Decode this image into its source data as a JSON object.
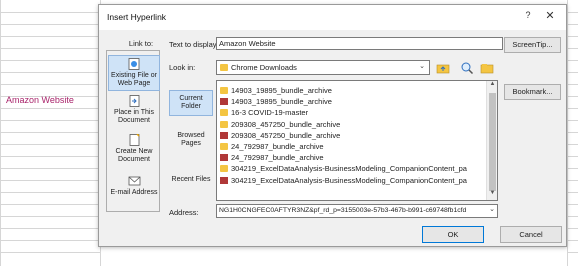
{
  "sheet": {
    "cell_text": "Amazon Website"
  },
  "dialog": {
    "title": "Insert Hyperlink",
    "help": "?",
    "close": "✕",
    "link_to_label": "Link to:",
    "link_to_items": [
      {
        "label": "Existing File or Web Page",
        "icon": "web-page-icon"
      },
      {
        "label": "Place in This Document",
        "icon": "document-place-icon"
      },
      {
        "label": "Create New Document",
        "icon": "new-document-icon"
      },
      {
        "label": "E-mail Address",
        "icon": "email-icon"
      }
    ],
    "text_to_display_label": "Text to display:",
    "text_to_display_value": "Amazon Website",
    "screentip_label": "ScreenTip...",
    "look_in_label": "Look in:",
    "look_in_value": "Chrome Downloads",
    "nav_items": [
      {
        "label": "Current Folder"
      },
      {
        "label": "Browsed Pages"
      },
      {
        "label": "Recent Files"
      }
    ],
    "files": [
      {
        "name": "14903_19895_bundle_archive",
        "type": "folder"
      },
      {
        "name": "14903_19895_bundle_archive",
        "type": "excel"
      },
      {
        "name": "16-3 COVID-19-master",
        "type": "folder"
      },
      {
        "name": "209308_457250_bundle_archive",
        "type": "folder"
      },
      {
        "name": "209308_457250_bundle_archive",
        "type": "excel"
      },
      {
        "name": "24_792987_bundle_archive",
        "type": "folder"
      },
      {
        "name": "24_792987_bundle_archive",
        "type": "excel"
      },
      {
        "name": "304219_ExcelDataAnalysis-BusinessModeling_CompanionContent_pa",
        "type": "folder"
      },
      {
        "name": "304219_ExcelDataAnalysis-BusinessModeling_CompanionContent_pa",
        "type": "excel"
      }
    ],
    "bookmark_label": "Bookmark...",
    "address_label": "Address:",
    "address_value": "NG1H0CNGFEC0AFTYR3NZ&pf_rd_p=3155003e-57b3-467b-b991-c69748fb1cfd",
    "ok_label": "OK",
    "cancel_label": "Cancel"
  },
  "colors": {
    "accent": "#0078d7",
    "selection": "#cfe3f7",
    "folder": "#f4c542",
    "excel_file": "#b03838",
    "hyperlink_text": "#a9246b"
  }
}
